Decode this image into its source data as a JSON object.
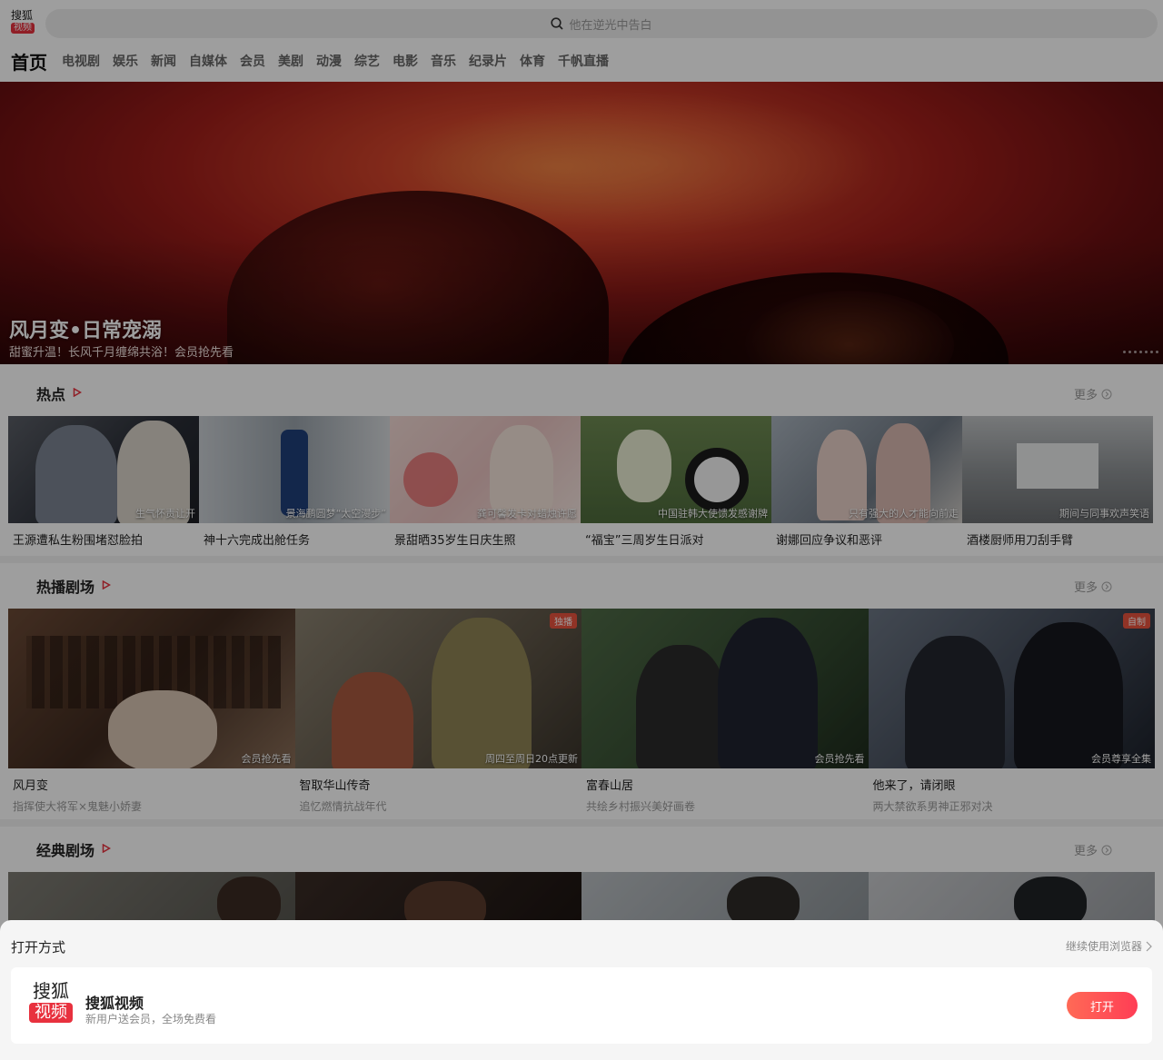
{
  "logo": {
    "line1": "搜狐",
    "line2": "视频"
  },
  "search": {
    "placeholder": "他在逆光中告白"
  },
  "nav": {
    "active": "首页",
    "items": [
      "电视剧",
      "娱乐",
      "新闻",
      "自媒体",
      "会员",
      "美剧",
      "动漫",
      "综艺",
      "电影",
      "音乐",
      "纪录片",
      "体育",
      "千帆直播"
    ]
  },
  "hero": {
    "title": "风月变•日常宠溺",
    "subtitle": "甜蜜升温！长风千月缠绵共浴！会员抢先看"
  },
  "hot": {
    "title": "热点",
    "more": "更多",
    "items": [
      {
        "caption": "生气怀责让开",
        "title": "王源遭私生粉围堵怼脸拍"
      },
      {
        "caption": "景海鹏圆梦“太空漫步”",
        "title": "神十六完成出舱任务"
      },
      {
        "caption": "龚可馨发卡对蜡烛许愿",
        "title": "景甜晒35岁生日庆生照"
      },
      {
        "caption": "中国驻韩大使馈发感谢牌",
        "title": "“福宝”三周岁生日派对"
      },
      {
        "caption": "只有强大的人才能向前走",
        "title": "谢娜回应争议和恶评"
      },
      {
        "caption": "期间与同事欢声笑语",
        "title": "酒楼厨师用刀刮手臂"
      }
    ]
  },
  "drama": {
    "title": "热播剧场",
    "more": "更多",
    "items": [
      {
        "badge": "",
        "caption": "会员抢先看",
        "title": "风月变",
        "sub": "指挥使大将军×鬼魅小娇妻"
      },
      {
        "badge": "独播",
        "caption": "周四至周日20点更新",
        "title": "智取华山传奇",
        "sub": "追忆燃情抗战年代"
      },
      {
        "badge": "",
        "caption": "会员抢先看",
        "title": "富春山居",
        "sub": "共绘乡村振兴美好画卷"
      },
      {
        "badge": "自制",
        "caption": "会员尊享全集",
        "title": "他来了，请闭眼",
        "sub": "两大禁欲系男神正邪对决"
      }
    ]
  },
  "classic": {
    "title": "经典剧场",
    "more": "更多"
  },
  "sheet": {
    "title": "打开方式",
    "continue": "继续使用浏览器",
    "app_logo_1": "搜狐",
    "app_logo_2": "视频",
    "app_name": "搜狐视频",
    "app_desc": "新用户送会员，全场免费看",
    "open": "打开"
  },
  "colors": {
    "brand": "#e8313e",
    "accent": "#ff3d55"
  }
}
